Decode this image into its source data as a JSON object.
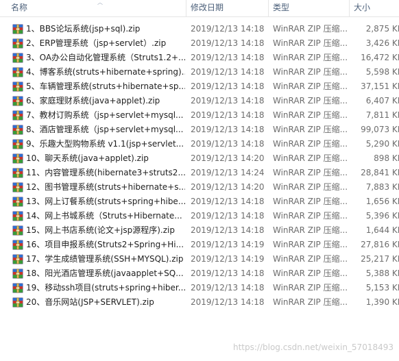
{
  "header": {
    "name_label": "名称",
    "date_label": "修改日期",
    "type_label": "类型",
    "size_label": "大小"
  },
  "files": [
    {
      "name": "1、BBS论坛系统(jsp+sql).zip",
      "date": "2019/12/13 14:18",
      "type": "WinRAR ZIP 压缩...",
      "size": "2,875 KB",
      "icon": "winrar-zip-icon"
    },
    {
      "name": "2、ERP管理系统（jsp+servlet）.zip",
      "date": "2019/12/13 14:18",
      "type": "WinRAR ZIP 压缩...",
      "size": "3,426 KB",
      "icon": "winrar-zip-icon"
    },
    {
      "name": "3、OA办公自动化管理系统（Struts1.2+...",
      "date": "2019/12/13 14:18",
      "type": "WinRAR ZIP 压缩...",
      "size": "16,472 KB",
      "icon": "winrar-zip-icon"
    },
    {
      "name": "4、博客系统(struts+hibernate+spring)...",
      "date": "2019/12/13 14:18",
      "type": "WinRAR ZIP 压缩...",
      "size": "5,598 KB",
      "icon": "winrar-zip-icon"
    },
    {
      "name": "5、车辆管理系统(struts+hibernate+sp...",
      "date": "2019/12/13 14:18",
      "type": "WinRAR ZIP 压缩...",
      "size": "37,151 KB",
      "icon": "winrar-zip-icon"
    },
    {
      "name": "6、家庭理财系统(java+applet).zip",
      "date": "2019/12/13 14:18",
      "type": "WinRAR ZIP 压缩...",
      "size": "6,407 KB",
      "icon": "winrar-zip-icon"
    },
    {
      "name": "7、教材订购系统（jsp+servlet+mysql...",
      "date": "2019/12/13 14:18",
      "type": "WinRAR ZIP 压缩...",
      "size": "7,811 KB",
      "icon": "winrar-zip-icon"
    },
    {
      "name": "8、酒店管理系统（jsp+servlet+mysql...",
      "date": "2019/12/13 14:18",
      "type": "WinRAR ZIP 压缩...",
      "size": "99,073 KB",
      "icon": "winrar-zip-icon"
    },
    {
      "name": "9、乐趣大型购物系统 v1.1(jsp+servlet...",
      "date": "2019/12/13 14:18",
      "type": "WinRAR ZIP 压缩...",
      "size": "5,290 KB",
      "icon": "winrar-zip-icon"
    },
    {
      "name": "10、聊天系统(java+applet).zip",
      "date": "2019/12/13 14:20",
      "type": "WinRAR ZIP 压缩...",
      "size": "898 KB",
      "icon": "winrar-zip-icon"
    },
    {
      "name": "11、内容管理系统(hibernate3+struts2...",
      "date": "2019/12/13 14:24",
      "type": "WinRAR ZIP 压缩...",
      "size": "28,841 KB",
      "icon": "winrar-zip-icon"
    },
    {
      "name": "12、图书管理系统(struts+hibernate+s...",
      "date": "2019/12/13 14:20",
      "type": "WinRAR ZIP 压缩...",
      "size": "7,883 KB",
      "icon": "winrar-zip-icon"
    },
    {
      "name": "13、网上订餐系统(struts+spring+hibe...",
      "date": "2019/12/13 14:18",
      "type": "WinRAR ZIP 压缩...",
      "size": "1,656 KB",
      "icon": "winrar-zip-icon"
    },
    {
      "name": "14、网上书城系统（Struts+Hibernate...",
      "date": "2019/12/13 14:18",
      "type": "WinRAR ZIP 压缩...",
      "size": "5,396 KB",
      "icon": "winrar-zip-icon"
    },
    {
      "name": "15、网上书店系统(论文+jsp源程序).zip",
      "date": "2019/12/13 14:18",
      "type": "WinRAR ZIP 压缩...",
      "size": "1,644 KB",
      "icon": "winrar-zip-icon"
    },
    {
      "name": "16、项目申报系统(Struts2+Spring+Hi...",
      "date": "2019/12/13 14:19",
      "type": "WinRAR ZIP 压缩...",
      "size": "27,816 KB",
      "icon": "winrar-zip-icon"
    },
    {
      "name": "17、学生成绩管理系统(SSH+MYSQL).zip",
      "date": "2019/12/13 14:19",
      "type": "WinRAR ZIP 压缩...",
      "size": "25,217 KB",
      "icon": "winrar-zip-icon"
    },
    {
      "name": "18、阳光酒店管理系统(javaapplet+SQ...",
      "date": "2019/12/13 14:18",
      "type": "WinRAR ZIP 压缩...",
      "size": "5,388 KB",
      "icon": "winrar-zip-icon"
    },
    {
      "name": "19、移动ssh项目(struts+spring+hiber...",
      "date": "2019/12/13 14:18",
      "type": "WinRAR ZIP 压缩...",
      "size": "5,153 KB",
      "icon": "winrar-zip-icon"
    },
    {
      "name": "20、音乐网站(JSP+SERVLET).zip",
      "date": "2019/12/13 14:18",
      "type": "WinRAR ZIP 压缩...",
      "size": "1,390 KB",
      "icon": "winrar-zip-icon"
    }
  ],
  "watermark": "https://blog.csdn.net/weixin_57018493",
  "colors": {
    "header_text": "#4c607a",
    "row_hover": "#e5f3ff",
    "secondary_text": "#6d6d6d"
  }
}
